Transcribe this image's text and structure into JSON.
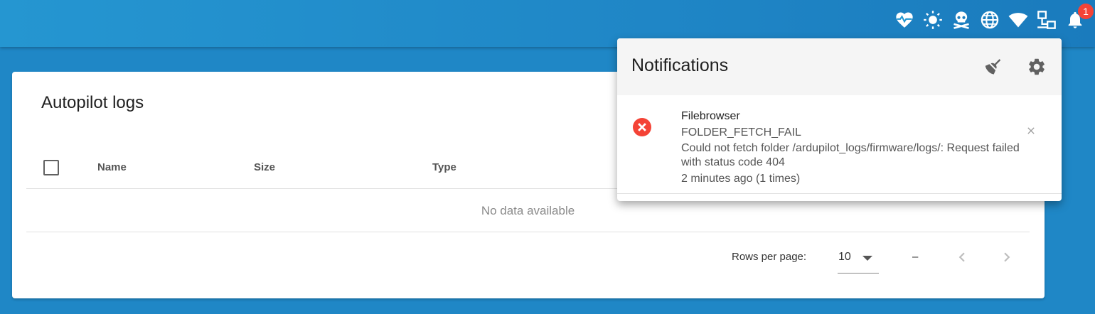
{
  "tray": {
    "icons": [
      "heartbeat-icon",
      "brightness-icon",
      "skull-crossbones-icon",
      "globe-icon",
      "wifi-icon",
      "network-icon",
      "bell-icon"
    ],
    "notification_count": "1"
  },
  "card": {
    "title": "Autopilot logs",
    "columns": [
      "Name",
      "Size",
      "Type"
    ],
    "empty_text": "No data available",
    "footer": {
      "rows_per_page_label": "Rows per page:",
      "rows_per_page_value": "10",
      "range_text": "–"
    }
  },
  "notifications": {
    "title": "Notifications",
    "items": [
      {
        "source": "Filebrowser",
        "code": "FOLDER_FETCH_FAIL",
        "message": "Could not fetch folder /ardupilot_logs/firmware/logs/: Request failed with status code 404",
        "time": "2 minutes ago (1 times)"
      }
    ]
  },
  "colors": {
    "topbar": "#1f87c6",
    "error": "#f44336",
    "badge": "#f44336"
  }
}
